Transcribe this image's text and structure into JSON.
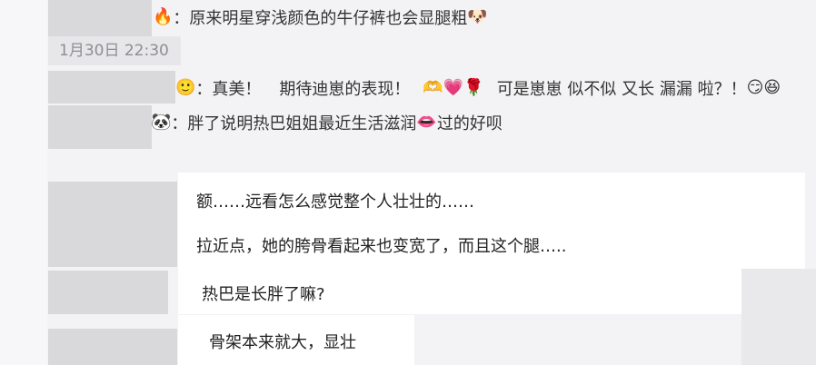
{
  "timestamp": "1月30日 22:30",
  "comments": [
    {
      "avatar_icon": "fire-icon",
      "separator": "：",
      "text": "原来明星穿浅颜色的牛仔裤也会显腿粗",
      "end_icon": "dog-face-icon"
    },
    {
      "avatar_icon": "face-icon",
      "separator": "：",
      "text_a": "真美！",
      "text_b": "期待迪崽的表现！",
      "icons": [
        "hand-heart-icon",
        "hearts-icon",
        "rose-icon"
      ],
      "text_c": "可是崽崽 似不似 又长 漏漏 啦？！",
      "end_icons": [
        "smirk-face-icon",
        "grin-face-icon"
      ]
    },
    {
      "avatar_icon": "panda-face-icon",
      "separator": "：",
      "text_a": "胖了说明热巴姐姐最近生活滋润",
      "mid_icon": "lips-icon",
      "text_b": "过的好呗"
    }
  ],
  "chat": {
    "bubble_1_line_1": "额……远看怎么感觉整个人壮壮的……",
    "bubble_1_line_2": "拉近点，她的胯骨看起来也变宽了，而且这个腿…..",
    "bubble_2": "热巴是长胖了嘛?",
    "bubble_3": "骨架本来就大，显壮"
  },
  "colors": {
    "background": "#f3f3f5",
    "redaction": "#d9d9db",
    "bubble": "#ffffff",
    "text": "#333333",
    "timestamp_text": "#8e8e93"
  }
}
